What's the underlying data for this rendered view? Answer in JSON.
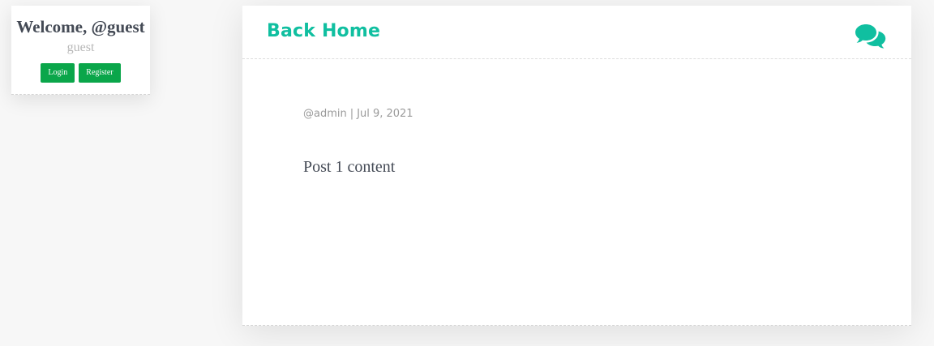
{
  "user_card": {
    "welcome": "Welcome, @guest",
    "username": "guest",
    "login_label": "Login",
    "register_label": "Register"
  },
  "header": {
    "back_home": "Back Home",
    "icon": "comments-icon"
  },
  "post": {
    "author": "@admin",
    "separator": "|",
    "date": "Jul 9, 2021",
    "content": "Post 1 content"
  },
  "colors": {
    "accent": "#10bfa0",
    "button": "#0aa64a"
  }
}
